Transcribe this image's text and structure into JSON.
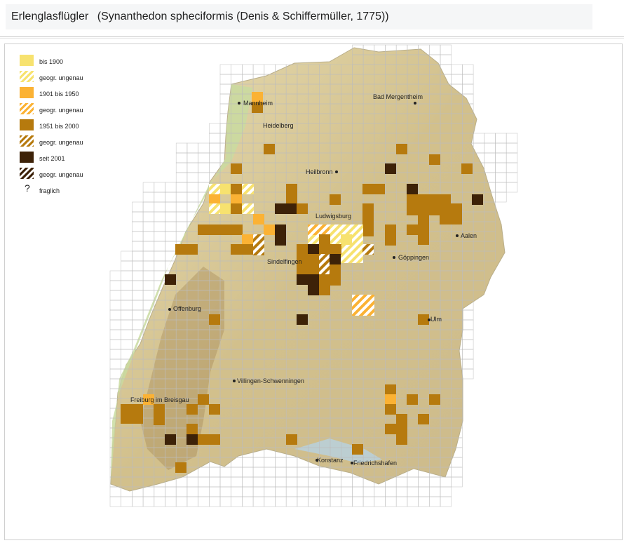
{
  "header": {
    "common_name": "Erlenglasflügler",
    "scientific_name": "(Synanthedon spheciformis (Denis & Schiffermüller, 1775))"
  },
  "legend": [
    {
      "label": "bis 1900",
      "color": "#f7e26f",
      "pattern": "solid"
    },
    {
      "label": "geogr. ungenau",
      "color": "#f7e26f",
      "pattern": "hatched"
    },
    {
      "label": "1901 bis 1950",
      "color": "#fbb234",
      "pattern": "solid"
    },
    {
      "label": "geogr. ungenau",
      "color": "#fbb234",
      "pattern": "hatched"
    },
    {
      "label": "1951 bis 2000",
      "color": "#b67a0e",
      "pattern": "solid"
    },
    {
      "label": "geogr. ungenau",
      "color": "#b67a0e",
      "pattern": "hatched"
    },
    {
      "label": "seit 2001",
      "color": "#3d2208",
      "pattern": "solid"
    },
    {
      "label": "geogr. ungenau",
      "color": "#3d2208",
      "pattern": "hatched"
    },
    {
      "label": "fraglich",
      "symbol": "?",
      "pattern": "symbol"
    }
  ],
  "towns": [
    {
      "name": "Mannheim"
    },
    {
      "name": "Heidelberg"
    },
    {
      "name": "Bad Mergentheim"
    },
    {
      "name": "Heilbronn"
    },
    {
      "name": "Ludwigsburg"
    },
    {
      "name": "Sindelfingen"
    },
    {
      "name": "Göppingen"
    },
    {
      "name": "Aalen"
    },
    {
      "name": "Offenburg"
    },
    {
      "name": "Ulm"
    },
    {
      "name": "Villingen-Schwenningen"
    },
    {
      "name": "Freiburg im Breisgau"
    },
    {
      "name": "Konstanz"
    },
    {
      "name": "Friedrichshafen"
    }
  ]
}
